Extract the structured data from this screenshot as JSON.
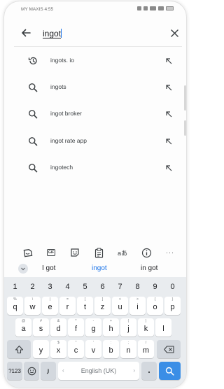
{
  "status_bar": {
    "carrier_time": "MY MAXIS 4:55"
  },
  "search": {
    "query": "ingot"
  },
  "suggestions": [
    {
      "text": "ingots. io",
      "icon": "history-icon"
    },
    {
      "text": "ingots",
      "icon": "search-icon"
    },
    {
      "text": "ingot broker",
      "icon": "search-icon"
    },
    {
      "text": "ingot rate app",
      "icon": "search-icon"
    },
    {
      "text": "ingotech",
      "icon": "search-icon"
    }
  ],
  "toolbar": {
    "gif_label": "GIF",
    "translate_label": "aあ",
    "more_label": "···"
  },
  "predictions": {
    "left": "I got",
    "center": "ingot",
    "right": "in got"
  },
  "keyboard": {
    "numbers": [
      "1",
      "2",
      "3",
      "4",
      "5",
      "6",
      "7",
      "8",
      "9",
      "0"
    ],
    "row1": [
      "q",
      "w",
      "e",
      "r",
      "t",
      "z",
      "u",
      "i",
      "o",
      "p"
    ],
    "row1_hints": [
      "%",
      "\\",
      "|",
      "=",
      "[",
      "]",
      "<",
      ">",
      "{",
      "}"
    ],
    "row2": [
      "a",
      "s",
      "d",
      "f",
      "g",
      "h",
      "j",
      "k",
      "l"
    ],
    "row2_hints": [
      "@",
      "#",
      "&",
      "*",
      "-",
      "+",
      "(",
      ")",
      ""
    ],
    "row3": [
      "y",
      "x",
      "c",
      "v",
      "b",
      "n",
      "m"
    ],
    "row3_hints": [
      "",
      "$",
      "\"",
      "'",
      ":",
      ";",
      "/"
    ],
    "symbols_label": "?123",
    "space_label": "English (UK)",
    "enter_color": "#3a8ee6"
  },
  "colors": {
    "accent": "#1a73e8",
    "keyboard_bg": "#e9ecef"
  }
}
